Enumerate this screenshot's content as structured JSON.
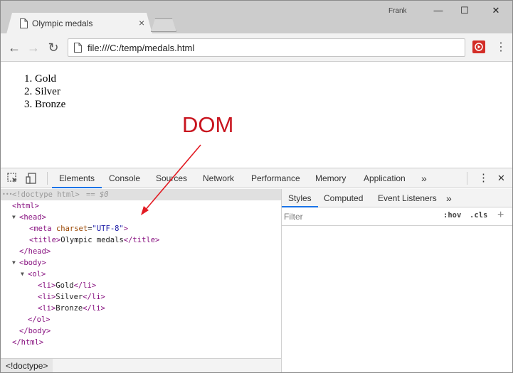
{
  "browser": {
    "tab_title": "Olympic medals",
    "tab_close": "×",
    "user_name": "Frank",
    "window_controls": {
      "minimize": "—",
      "maximize": "☐",
      "close": "✕"
    },
    "nav": {
      "back": "←",
      "forward": "→",
      "reload": "↻"
    },
    "url": "file:///C:/temp/medals.html",
    "menu": "⋮"
  },
  "page": {
    "list_items": [
      "1. Gold",
      "2. Silver",
      "3. Bronze"
    ]
  },
  "annotation": {
    "label": "DOM",
    "color": "#c8141e"
  },
  "devtools": {
    "tabs": [
      "Elements",
      "Console",
      "Sources",
      "Network",
      "Performance",
      "Memory",
      "Application"
    ],
    "active_tab": "Elements",
    "more_tabs": "»",
    "menu": "⋮",
    "close": "✕",
    "dom_tree": {
      "doctype_dots": "•••",
      "doctype": "<!doctype html>",
      "selected_marker": "== $0",
      "html_open": "<html>",
      "head_open": "<head>",
      "meta_tag": "<meta",
      "meta_attr": "charset",
      "meta_val": "\"UTF-8\"",
      "meta_close": ">",
      "title_open": "<title>",
      "title_text": "Olympic medals",
      "title_close": "</title>",
      "head_close": "</head>",
      "body_open": "<body>",
      "ol_open": "<ol>",
      "li_open": "<li>",
      "li_close": "</li>",
      "li_items": [
        "Gold",
        "Silver",
        "Bronze"
      ],
      "ol_close": "</ol>",
      "body_close": "</body>",
      "html_close": "</html>"
    },
    "breadcrumb": "<!doctype>",
    "styles_pane": {
      "tabs": [
        "Styles",
        "Computed",
        "Event Listeners"
      ],
      "active_tab": "Styles",
      "more_tabs": "»",
      "filter_placeholder": "Filter",
      "hov": ":hov",
      "cls": ".cls",
      "plus": "+"
    }
  }
}
